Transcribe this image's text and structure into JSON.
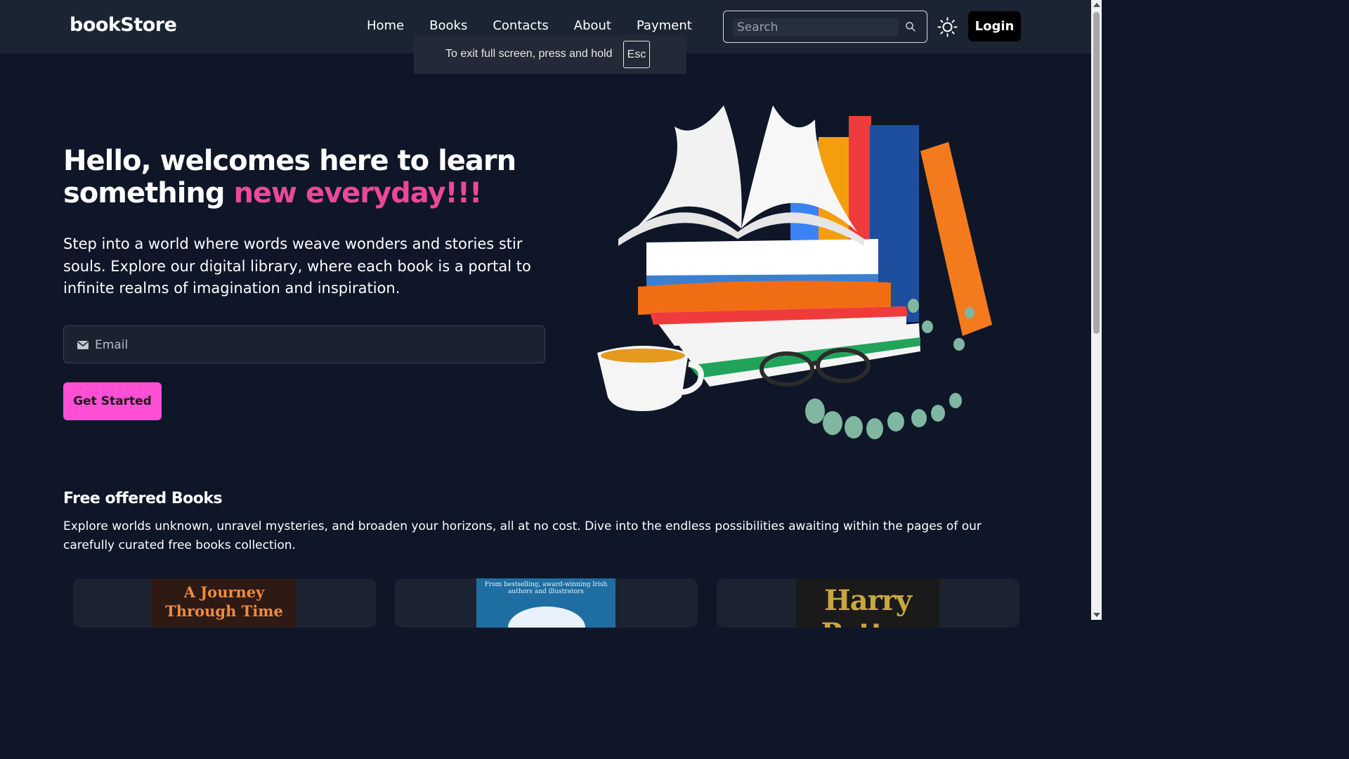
{
  "navbar": {
    "brand": "bookStore",
    "links": [
      "Home",
      "Books",
      "Contacts",
      "About",
      "Payment"
    ],
    "search_placeholder": "Search",
    "login_label": "Login"
  },
  "fullscreen_notice": {
    "text": "To exit full screen, press and hold",
    "key": "Esc"
  },
  "hero": {
    "title_plain": "Hello, welcomes here to learn something ",
    "title_accent": "new everyday!!!",
    "description": "Step into a world where words weave wonders and stories stir souls. Explore our digital library, where each book is a portal to infinite realms of imagination and inspiration.",
    "email_placeholder": "Email",
    "cta_label": "Get Started"
  },
  "free_books": {
    "title": "Free offered Books",
    "description": "Explore worlds unknown, unravel mysteries, and broaden your horizons, all at no cost. Dive into the endless possibilities awaiting within the pages of our carefully curated free books collection.",
    "cards": [
      {
        "cover_text": "A Journey Through Time"
      },
      {
        "cover_text": "From bestselling, award-winning Irish authors and illustrators"
      },
      {
        "cover_text": "Harry Potter"
      }
    ]
  },
  "colors": {
    "background": "#0e1628",
    "navbar": "#1b2433",
    "accent_pink": "#ec4899",
    "cta": "#ff4fd4"
  },
  "icons": {
    "search": "search-icon",
    "theme": "sun-icon",
    "mail": "mail-icon"
  }
}
